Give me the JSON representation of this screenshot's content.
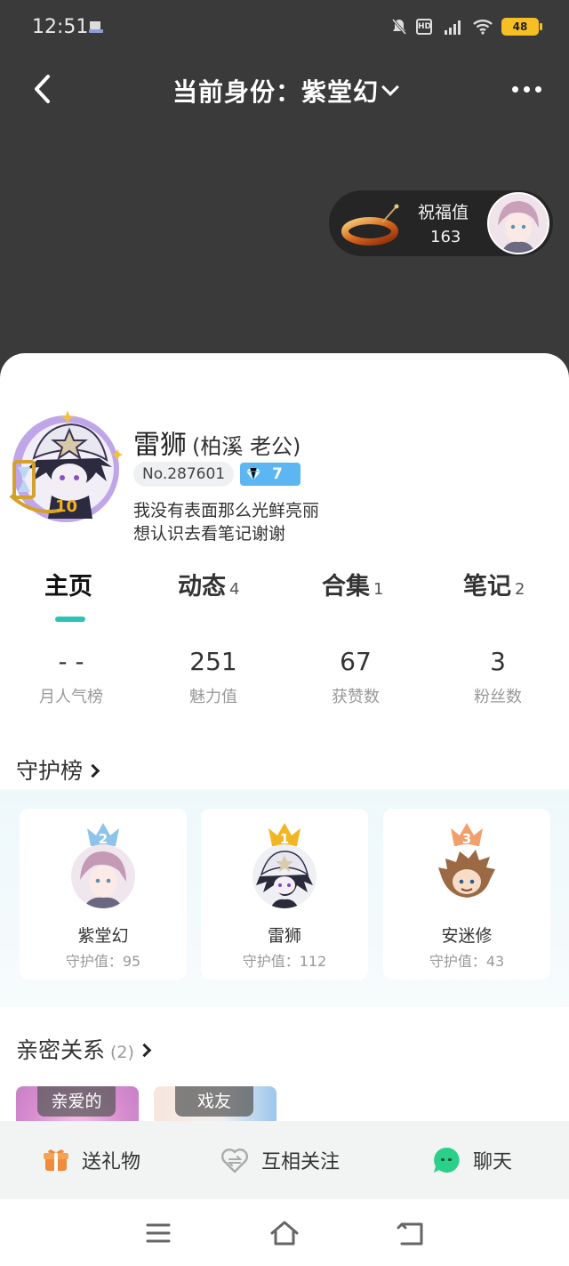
{
  "status_bar": {
    "time": "12:51",
    "signal": "5G",
    "hd": "HD",
    "battery": "48"
  },
  "nav": {
    "title": "当前身份：紫堂幻"
  },
  "blessing": {
    "label": "祝福值",
    "value": "163"
  },
  "profile": {
    "name": "雷狮",
    "alias": "(柏溪 老公)",
    "id": "No.287601",
    "level": "7",
    "bio_line1": "我没有表面那么光鲜亮丽",
    "bio_line2": "想认识去看笔记谢谢",
    "avatar_badge": "10"
  },
  "tabs": [
    {
      "label": "主页",
      "count": ""
    },
    {
      "label": "动态",
      "count": "4"
    },
    {
      "label": "合集",
      "count": "1"
    },
    {
      "label": "笔记",
      "count": "2"
    }
  ],
  "stats": [
    {
      "value": "- -",
      "label": "月人气榜"
    },
    {
      "value": "251",
      "label": "魅力值"
    },
    {
      "value": "67",
      "label": "获赞数"
    },
    {
      "value": "3",
      "label": "粉丝数"
    }
  ],
  "guard": {
    "title": "守护榜",
    "items": [
      {
        "rank": "2",
        "name": "紫堂幻",
        "value": "守护值：95"
      },
      {
        "rank": "1",
        "name": "雷狮",
        "value": "守护值：112"
      },
      {
        "rank": "3",
        "name": "安迷修",
        "value": "守护值：43"
      }
    ]
  },
  "relations": {
    "title": "亲密关系",
    "count": "(2)",
    "items": [
      {
        "label": "亲爱的"
      },
      {
        "label": "戏友"
      }
    ]
  },
  "actions": {
    "gift": "送礼物",
    "follow": "互相关注",
    "chat": "聊天"
  },
  "colors": {
    "accent": "#2ec3b5",
    "level_badge": "#5cb6f2",
    "rank1": "#f2b622",
    "rank2": "#8ec3ea",
    "rank3": "#f0a06a"
  }
}
